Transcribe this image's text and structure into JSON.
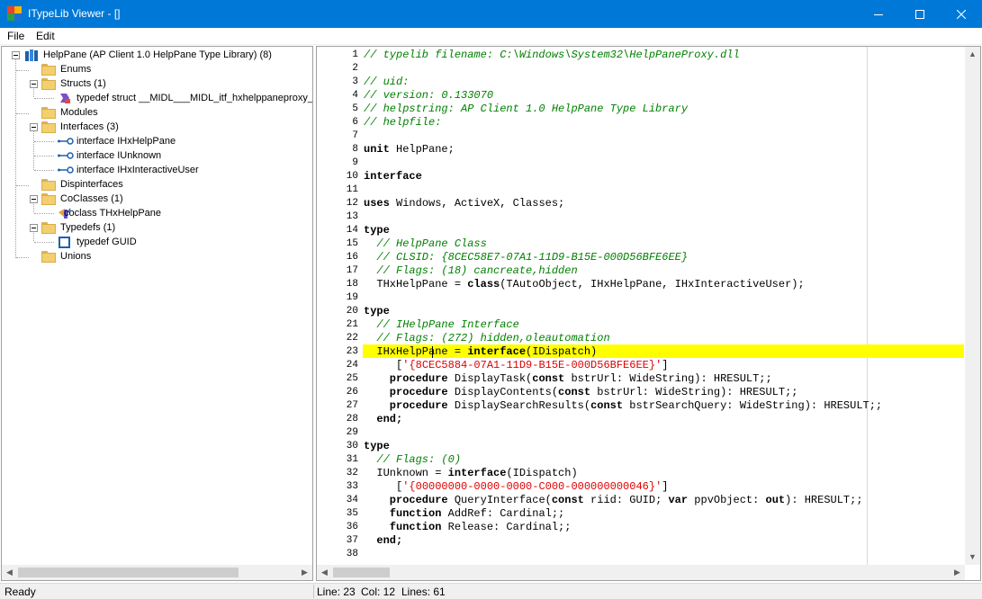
{
  "window": {
    "title": "ITypeLib Viewer - []"
  },
  "menu": {
    "file": "File",
    "edit": "Edit"
  },
  "tree": {
    "root": "HelpPane (AP Client 1.0 HelpPane Type Library) (8)",
    "enums": "Enums",
    "structs": "Structs (1)",
    "struct_item": "typedef struct __MIDL___MIDL_itf_hxhelppaneproxy_",
    "modules": "Modules",
    "interfaces": "Interfaces (3)",
    "iface_1": "interface IHxHelpPane",
    "iface_2": "interface IUnknown",
    "iface_3": "interface IHxInteractiveUser",
    "dispinterfaces": "Dispinterfaces",
    "coclasses": "CoClasses (1)",
    "coclass_item": "coclass THxHelpPane",
    "typedefs": "Typedefs (1)",
    "typedef_item": "typedef GUID",
    "unions": "Unions"
  },
  "code": {
    "l1": "// typelib filename: C:\\Windows\\System32\\HelpPaneProxy.dll",
    "l3": "// uid:",
    "l4": "// version: 0.133070",
    "l5": "// helpstring: AP Client 1.0 HelpPane Type Library",
    "l6": "// helpfile:",
    "l8_kw": "unit",
    "l8_rest": " HelpPane;",
    "l10": "interface",
    "l12_kw": "uses",
    "l12_rest": " Windows, ActiveX, Classes;",
    "l14": "type",
    "l15": "  // HelpPane Class",
    "l16": "  // CLSID: {8CEC58E7-07A1-11D9-B15E-000D56BFE6EE}",
    "l17": "  // Flags: (18) cancreate,hidden",
    "l18_a": "  THxHelpPane = ",
    "l18_kw": "class",
    "l18_b": "(TAutoObject, IHxHelpPane, IHxInteractiveUser);",
    "l20": "type",
    "l21": "  // IHelpPane Interface",
    "l22": "  // Flags: (272) hidden,oleautomation",
    "l23_a": "  IHxHelpPane = ",
    "l23_kw": "interface",
    "l23_b": "(IDispatch)",
    "l24_a": "     [",
    "l24_str": "'{8CEC5884-07A1-11D9-B15E-000D56BFE6EE}'",
    "l24_b": "]",
    "l25_kw": "    procedure",
    "l25_a": " DisplayTask(",
    "l25_kw2": "const",
    "l25_b": " bstrUrl: WideString): HRESULT;;",
    "l26_kw": "    procedure",
    "l26_a": " DisplayContents(",
    "l26_kw2": "const",
    "l26_b": " bstrUrl: WideString): HRESULT;;",
    "l27_kw": "    procedure",
    "l27_a": " DisplaySearchResults(",
    "l27_kw2": "const",
    "l27_b": " bstrSearchQuery: WideString): HRESULT;;",
    "l28": "  end;",
    "l30": "type",
    "l31": "  // Flags: (0)",
    "l32_a": "  IUnknown = ",
    "l32_kw": "interface",
    "l32_b": "(IDispatch)",
    "l33_a": "     [",
    "l33_str": "'{00000000-0000-0000-C000-000000000046}'",
    "l33_b": "]",
    "l34_kw": "    procedure",
    "l34_a": " QueryInterface(",
    "l34_kw2": "const",
    "l34_b": " riid: GUID; ",
    "l34_kw3": "var",
    "l34_c": " ppvObject: ",
    "l34_kw4": "out",
    "l34_d": "): HRESULT;;",
    "l35_kw": "    function",
    "l35_a": " AddRef: Cardinal;;",
    "l36_kw": "    function",
    "l36_a": " Release: Cardinal;;",
    "l37": "  end;"
  },
  "line_numbers": [
    "1",
    "2",
    "3",
    "4",
    "5",
    "6",
    "7",
    "8",
    "9",
    "10",
    "11",
    "12",
    "13",
    "14",
    "15",
    "16",
    "17",
    "18",
    "19",
    "20",
    "21",
    "22",
    "23",
    "24",
    "25",
    "26",
    "27",
    "28",
    "29",
    "30",
    "31",
    "32",
    "33",
    "34",
    "35",
    "36",
    "37",
    "38"
  ],
  "status": {
    "ready": "Ready",
    "line": "Line: 23",
    "col": "Col: 12",
    "lines": "Lines: 61"
  },
  "scroll_arrows": {
    "left": "◀",
    "right": "▶",
    "up": "▲",
    "down": "▼"
  },
  "colors": {
    "titlebar": "#0078d7",
    "highlight": "#ffff00",
    "comment": "#008000",
    "string": "#e00000"
  }
}
